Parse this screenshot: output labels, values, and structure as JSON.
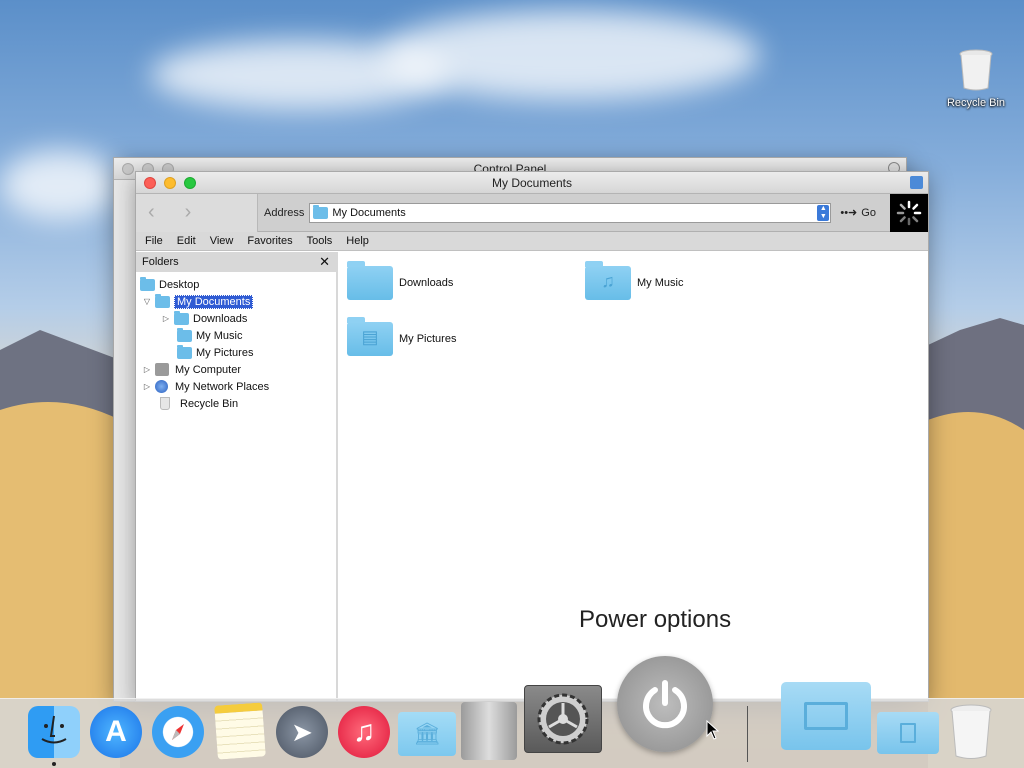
{
  "desktop": {
    "recycle_bin_label": "Recycle Bin"
  },
  "back_window": {
    "title": "Control Panel"
  },
  "window": {
    "title": "My Documents",
    "address_label": "Address",
    "address_value": "My Documents",
    "go_label": "Go",
    "menu": [
      "File",
      "Edit",
      "View",
      "Favorites",
      "Tools",
      "Help"
    ],
    "folders_header": "Folders",
    "tree": [
      {
        "label": "Desktop",
        "level": 0,
        "icon": "folder-icon"
      },
      {
        "label": "My Documents",
        "level": 1,
        "icon": "folder-icon",
        "selected": true,
        "expanded": true
      },
      {
        "label": "Downloads",
        "level": 2,
        "icon": "folder-icon",
        "collapsed": true
      },
      {
        "label": "My Music",
        "level": 2,
        "icon": "folder-icon"
      },
      {
        "label": "My Pictures",
        "level": 2,
        "icon": "folder-icon"
      },
      {
        "label": "My Computer",
        "level": 1,
        "icon": "computer-icon",
        "collapsed": true
      },
      {
        "label": "My Network Places",
        "level": 1,
        "icon": "network-icon",
        "collapsed": true
      },
      {
        "label": "Recycle Bin",
        "level": 1,
        "icon": "trash-icon"
      }
    ],
    "items": [
      {
        "label": "Downloads",
        "icon": "folder-icon"
      },
      {
        "label": "My Music",
        "icon": "music-folder-icon"
      },
      {
        "label": "My Pictures",
        "icon": "pictures-folder-icon"
      }
    ]
  },
  "overlay": {
    "power_label": "Power options"
  },
  "dock": {
    "items": [
      "finder-icon",
      "app-store-icon",
      "safari-icon",
      "notes-icon",
      "launchpad-icon",
      "itunes-icon",
      "library-folder-icon",
      "mac-pro-icon",
      "system-preferences-icon",
      "power-icon",
      "documents-folder-icon",
      "file-folder-icon",
      "trash-icon"
    ]
  },
  "colors": {
    "selection": "#2f5bd3",
    "folder": "#6cbde9",
    "close": "#fc5f57",
    "minimize": "#fdbc2e",
    "zoom": "#28c840"
  }
}
